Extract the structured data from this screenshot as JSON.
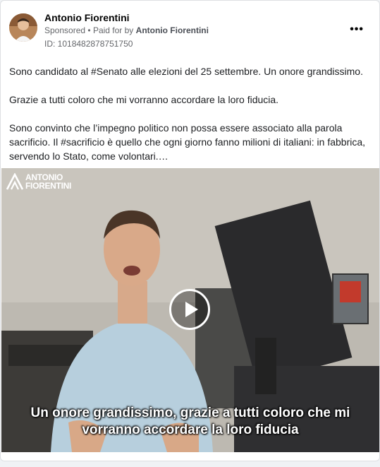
{
  "post": {
    "author": "Antonio Fiorentini",
    "sponsored_label": "Sponsored",
    "paid_for_prefix": "Paid for by",
    "paid_for_name": "Antonio Fiorentini",
    "ad_id": "ID: 1018482878751750",
    "more_icon": "more-dots-icon"
  },
  "body": {
    "paragraphs": [
      "Sono candidato al #Senato alle elezioni del 25 settembre. Un onore grandissimo.",
      "Grazie a tutti coloro che mi vorranno accordare la loro fiducia.",
      "Sono convinto che l’impegno politico non possa essere associato alla parola sacrificio. Il #sacrificio è quello che ogni giorno fanno milioni di italiani: in fabbrica, servendo lo Stato, come volontari.…"
    ]
  },
  "video": {
    "brand_line1": "ANTONIO",
    "brand_line2": "FIORENTINI",
    "caption_line1": "Un onore grandissimo, grazie a tutti coloro che mi",
    "caption_line2": "vorranno accordare la loro fiducia",
    "play_icon": "play-icon"
  }
}
